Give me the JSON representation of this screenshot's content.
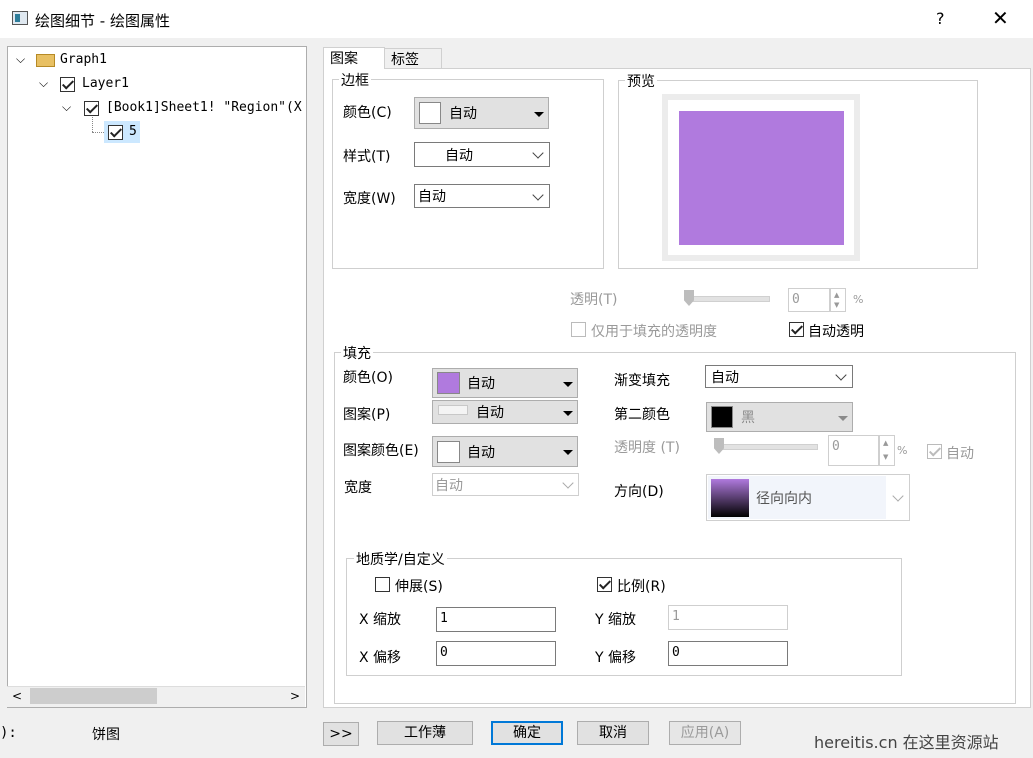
{
  "window": {
    "title": "绘图细节 - 绘图属性",
    "help": "?",
    "close": "✕"
  },
  "tree": {
    "items": [
      {
        "label": "Graph1"
      },
      {
        "label": "Layer1"
      },
      {
        "label": "[Book1]Sheet1! \"Region\"(X"
      },
      {
        "label": "5"
      }
    ]
  },
  "tabs": [
    {
      "label": "图案"
    },
    {
      "label": "标签"
    }
  ],
  "border": {
    "title": "边框",
    "color_label": "颜色(C)",
    "color_value": "自动",
    "style_label": "样式(T)",
    "style_value": "自动",
    "width_label": "宽度(W)",
    "width_value": "自动"
  },
  "preview": {
    "title": "预览",
    "fill_color": "#b07ade"
  },
  "transparency": {
    "label": "透明(T)",
    "value": "0",
    "unit": "%",
    "fill_only_label": "仅用于填充的透明度",
    "auto_label": "自动透明"
  },
  "fill": {
    "title": "填充",
    "color_label": "颜色(O)",
    "color_value": "自动",
    "color_hex": "#b07ade",
    "pattern_label": "图案(P)",
    "pattern_value": "自动",
    "pattern_color_label": "图案颜色(E)",
    "pattern_color_value": "自动",
    "width_label": "宽度",
    "width_value": "自动",
    "gradient_label": "渐变填充",
    "gradient_value": "自动",
    "second_color_label": "第二颜色",
    "second_color_value": "黑",
    "transparency_label": "透明度 (T)",
    "transparency_value": "0",
    "transparency_unit": "%",
    "auto_label": "自动",
    "direction_label": "方向(D)",
    "direction_value": "径向向内"
  },
  "geology": {
    "title": "地质学/自定义",
    "stretch_label": "伸展(S)",
    "scale_label": "比例(R)",
    "x_zoom_label": "X 缩放",
    "x_zoom_value": "1",
    "y_zoom_label": "Y 缩放",
    "y_zoom_value": "1",
    "x_offset_label": "X 偏移",
    "x_offset_value": "0",
    "y_offset_label": "Y 偏移",
    "y_offset_value": "0"
  },
  "footer": {
    "left_label": "):",
    "plot_type": "饼图",
    "expand_btn": ">>",
    "workbook_btn": "工作薄",
    "ok_btn": "确定",
    "cancel_btn": "取消",
    "apply_btn": "应用(A)"
  },
  "watermark": "hereitis.cn 在这里资源站"
}
